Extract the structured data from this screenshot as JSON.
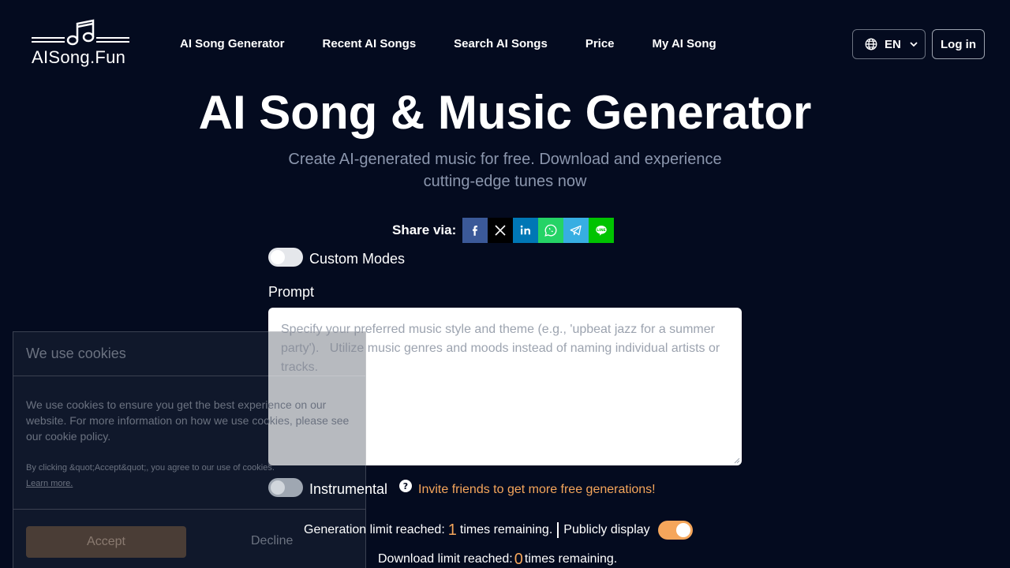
{
  "header": {
    "logo_text": "AISong.Fun",
    "nav": [
      "AI Song Generator",
      "Recent AI Songs",
      "Search AI Songs",
      "Price",
      "My AI Song"
    ],
    "lang_label": "EN",
    "login_label": "Log in"
  },
  "hero": {
    "title": "AI Song & Music Generator",
    "subtitle": "Create AI-generated music for free. Download and experience cutting-edge tunes now"
  },
  "share": {
    "label": "Share via:",
    "buttons": [
      {
        "icon": "facebook-icon",
        "color": "#3b5998"
      },
      {
        "icon": "x-icon",
        "color": "#000000"
      },
      {
        "icon": "linkedin-icon",
        "color": "#0077b5"
      },
      {
        "icon": "whatsapp-icon",
        "color": "#25d366"
      },
      {
        "icon": "telegram-icon",
        "color": "#37aee2"
      },
      {
        "icon": "line-icon",
        "color": "#00c300"
      }
    ]
  },
  "form": {
    "custom_modes_label": "Custom Modes",
    "custom_modes_on": false,
    "prompt_label": "Prompt",
    "prompt_placeholder": "Specify your preferred music style and theme (e.g., 'upbeat jazz for a summer party').   Utilize music genres and moods instead of naming individual artists or tracks.",
    "prompt_value": "",
    "instrumental_label": "Instrumental",
    "instrumental_on": false,
    "invite_text": "Invite friends to get more free generations!",
    "generation_prefix": "Generation limit reached:",
    "generation_count": "1",
    "generation_suffix": "times remaining.",
    "public_label": "Publicly display",
    "public_on": true,
    "download_prefix": "Download limit reached:",
    "download_count": "0",
    "download_suffix": "times remaining."
  },
  "cookie": {
    "title": "We use cookies",
    "body": "We use cookies to ensure you get the best experience on our website. For more information on how we use cookies, please see our cookie policy.",
    "small_text": "By clicking &quot;Accept&quot;, you agree to our use of cookies.",
    "learn_more": "Learn more.",
    "accept_label": "Accept",
    "decline_label": "Decline"
  },
  "colors": {
    "background": "#040b1f",
    "accent": "#f5a65b",
    "muted_text": "#8b96ad"
  }
}
